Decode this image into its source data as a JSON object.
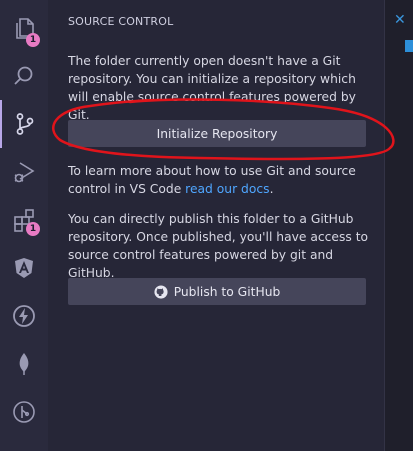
{
  "activity_bar": {
    "items": [
      {
        "id": "explorer",
        "icon": "files-icon",
        "badge": "1"
      },
      {
        "id": "search",
        "icon": "search-icon"
      },
      {
        "id": "source-control",
        "icon": "source-control-icon",
        "active": true
      },
      {
        "id": "run-debug",
        "icon": "run-debug-icon"
      },
      {
        "id": "extensions",
        "icon": "extensions-icon",
        "badge": "1"
      },
      {
        "id": "angular",
        "icon": "angular-icon"
      },
      {
        "id": "thunder",
        "icon": "lightning-icon"
      },
      {
        "id": "mongodb",
        "icon": "leaf-icon"
      },
      {
        "id": "git-graph",
        "icon": "git-branch-icon"
      }
    ]
  },
  "sidebar": {
    "title": "SOURCE CONTROL",
    "intro_text": "The folder currently open doesn't have a Git repository. You can initialize a repository which will enable source control features powered by Git.",
    "init_button": "Initialize Repository",
    "learn_text": "To learn more about how to use Git and source control in VS Code ",
    "learn_link": "read our docs",
    "learn_suffix": ".",
    "publish_text": "You can directly publish this folder to a GitHub repository. Once published, you'll have access to source control features powered by git and GitHub.",
    "publish_button": "Publish to GitHub"
  },
  "colors": {
    "accent": "#b8a7e8",
    "badge": "#e87bc4",
    "link": "#4fa6ff",
    "annotation": "#e0141b"
  }
}
